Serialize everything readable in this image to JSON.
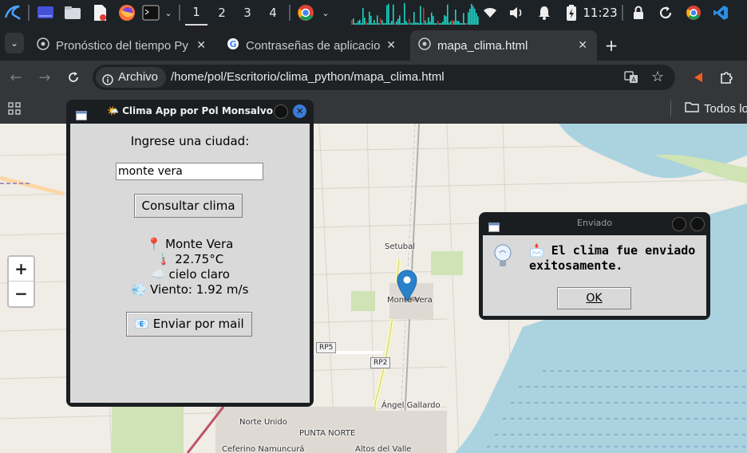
{
  "taskbar": {
    "workspaces": [
      "1",
      "2",
      "3",
      "4"
    ],
    "active_workspace": "1",
    "clock": "11:23",
    "colors": {
      "bg": "#1d2227",
      "cpu_graph": "#1ed1c2"
    }
  },
  "browser": {
    "tabs": [
      {
        "title": "Pronóstico del tiempo Py",
        "icon": "globe-icon"
      },
      {
        "title": "Contraseñas de aplicacio",
        "icon": "google-icon"
      },
      {
        "title": "mapa_clima.html",
        "icon": "globe-icon",
        "active": true
      }
    ],
    "new_tab_label": "+",
    "address": {
      "chip_label": "Archivo",
      "url": "/home/pol/Escritorio/clima_python/mapa_clima.html"
    },
    "bookmarks": {
      "folder_label": "Todos lo"
    }
  },
  "map": {
    "zoom_in": "+",
    "zoom_out": "−",
    "labels": {
      "setubal": "Setubal",
      "monte_vera": "Monte Vera",
      "angel_gallardo": "Ángel Gallardo",
      "norte_unido": "Norte Unido",
      "punta_norte": "PUNTA NORTE",
      "ceferino": "Ceferino Namuncurá",
      "altos_del_valle": "Altos del Valle",
      "rp5": "RP5",
      "rp2": "RP2"
    },
    "marker_color": "#2a81cb"
  },
  "app": {
    "title": "🌤️ Clima App por Pol Monsalvo",
    "prompt": "Ingrese una ciudad:",
    "city_input": "monte vera",
    "consult_button": "Consultar clima",
    "result": {
      "city": "📍 Monte Vera",
      "temperature": "🌡️ 22.75°C",
      "description": "☁️ cielo claro",
      "wind": "💨 Viento: 1.92 m/s"
    },
    "email_button": "📧 Enviar por mail"
  },
  "dialog": {
    "title": "Enviado",
    "message_line1": "📩 El clima fue enviado",
    "message_line2": "exitosamente.",
    "ok_button": "OK"
  }
}
